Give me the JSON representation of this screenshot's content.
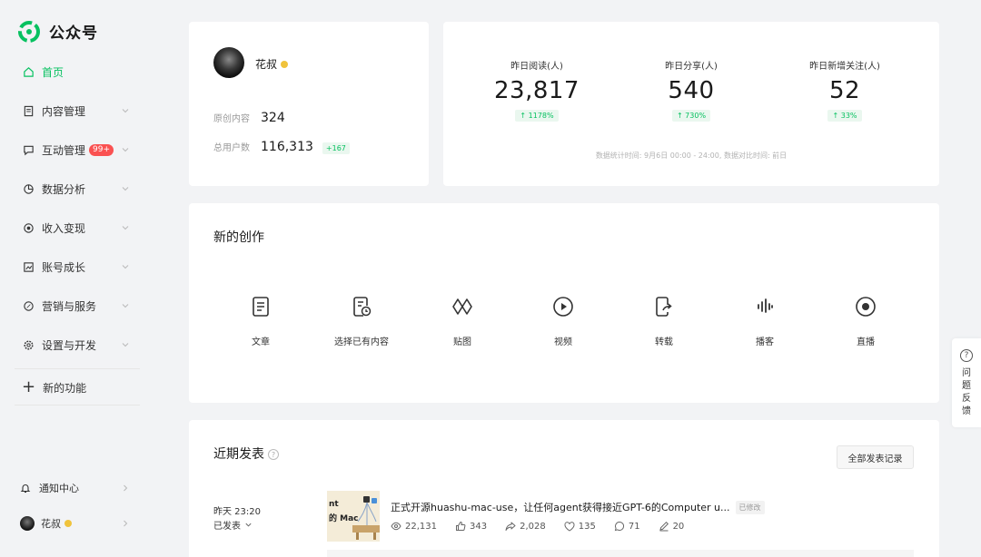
{
  "brand": {
    "name": "公众号",
    "accent": "#07c160"
  },
  "sidebar": {
    "items": [
      {
        "label": "首页",
        "icon": "home-icon",
        "active": true
      },
      {
        "label": "内容管理",
        "icon": "document-icon"
      },
      {
        "label": "互动管理",
        "icon": "chat-icon",
        "badge": "99+"
      },
      {
        "label": "数据分析",
        "icon": "pie-chart-icon"
      },
      {
        "label": "收入变现",
        "icon": "coin-icon"
      },
      {
        "label": "账号成长",
        "icon": "growth-chart-icon"
      },
      {
        "label": "营销与服务",
        "icon": "compass-icon"
      },
      {
        "label": "设置与开发",
        "icon": "gear-icon"
      }
    ],
    "new_feature": "新的功能",
    "notifications": "通知中心",
    "user": "花叔"
  },
  "profile": {
    "name": "花叔",
    "original_label": "原创内容",
    "original_value": "324",
    "users_label": "总用户数",
    "users_value": "116,313",
    "users_delta": "+167"
  },
  "stats": {
    "items": [
      {
        "label": "昨日阅读(人)",
        "value": "23,817",
        "change": "↑ 1178%"
      },
      {
        "label": "昨日分享(人)",
        "value": "540",
        "change": "↑ 730%"
      },
      {
        "label": "昨日新增关注(人)",
        "value": "52",
        "change": "↑ 33%"
      }
    ],
    "note": "数据统计时间: 9月6日 00:00 - 24:00, 数据对比时间: 前日"
  },
  "create": {
    "title": "新的创作",
    "tools": [
      {
        "label": "文章",
        "icon": "article-icon"
      },
      {
        "label": "选择已有内容",
        "icon": "existing-content-icon"
      },
      {
        "label": "贴图",
        "icon": "image-post-icon"
      },
      {
        "label": "视频",
        "icon": "video-play-icon"
      },
      {
        "label": "转载",
        "icon": "repost-icon"
      },
      {
        "label": "播客",
        "icon": "podcast-icon"
      },
      {
        "label": "直播",
        "icon": "live-icon"
      }
    ]
  },
  "recent": {
    "title": "近期发表",
    "all_button": "全部发表记录",
    "post": {
      "time": "昨天 23:20",
      "status": "已发表",
      "thumb_text_1": "nt",
      "thumb_text_2": "的 Mac",
      "title": "正式开源huashu-mac-use，让任何agent获得接近GPT-6的Computer u...",
      "edited": "已修改",
      "metrics": {
        "views": "22,131",
        "likes": "343",
        "shares": "2,028",
        "favorites": "135",
        "comments": "71",
        "edits": "20"
      }
    }
  },
  "feedback": {
    "text": "问题反馈"
  }
}
